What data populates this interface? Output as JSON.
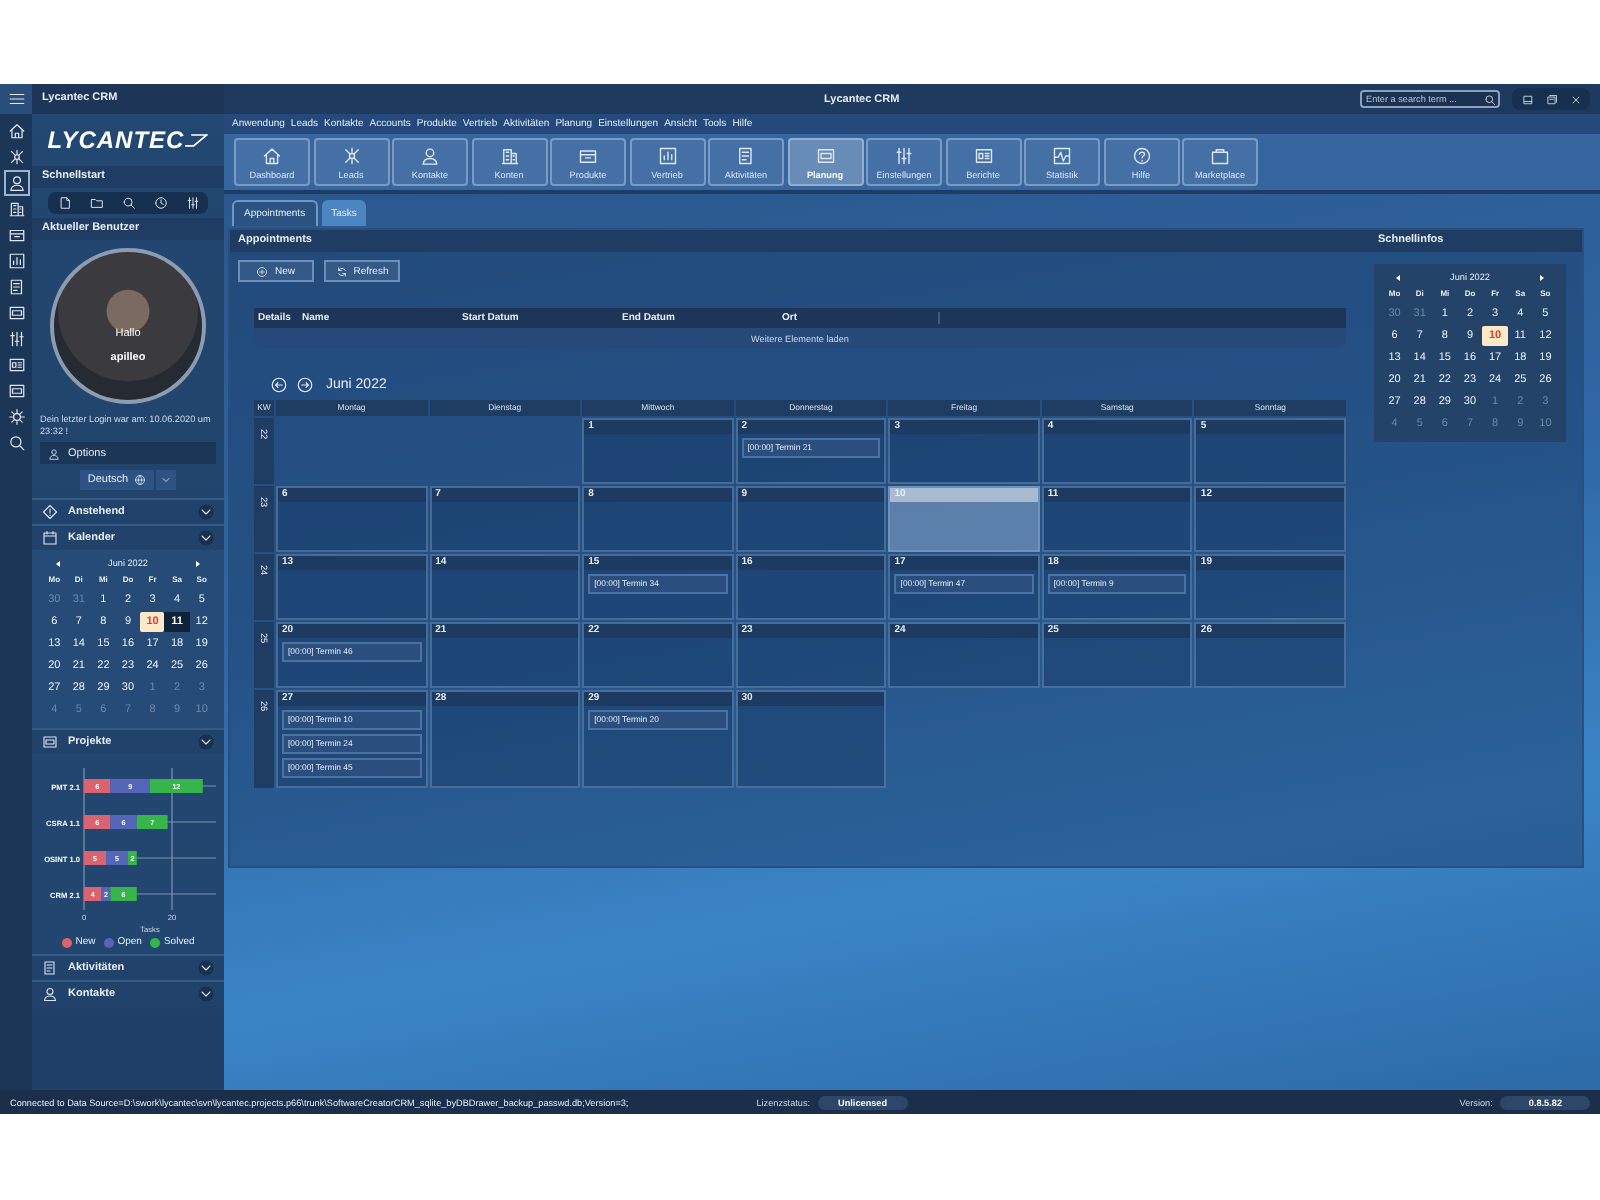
{
  "left_panel": {
    "title": "Lycantec CRM",
    "logo": "LYCANTEC",
    "quickstart": {
      "title": "Schnellstart"
    },
    "user": {
      "title": "Aktueller Benutzer",
      "greeting": "Hallo",
      "name": "apilleo",
      "last_login": "Dein letzter Login war am:  10.06.2020 um 23:32 !",
      "options": "Options",
      "language": "Deutsch"
    },
    "sections": [
      {
        "title": "Anstehend",
        "kind": "plain"
      },
      {
        "title": "Kalender",
        "kind": "calendar",
        "calendar": {
          "month": "Juni 2022",
          "weekdays": [
            "Mo",
            "Di",
            "Mi",
            "Do",
            "Fr",
            "Sa",
            "So"
          ],
          "days": [
            {
              "label": "30",
              "outside": true,
              "today": false,
              "selected": false
            },
            {
              "label": "31",
              "outside": true,
              "today": false,
              "selected": false
            },
            {
              "label": "1",
              "outside": false,
              "today": false,
              "selected": false
            },
            {
              "label": "2",
              "outside": false,
              "today": false,
              "selected": false
            },
            {
              "label": "3",
              "outside": false,
              "today": false,
              "selected": false
            },
            {
              "label": "4",
              "outside": false,
              "today": false,
              "selected": false
            },
            {
              "label": "5",
              "outside": false,
              "today": false,
              "selected": false
            },
            {
              "label": "6",
              "outside": false,
              "today": false,
              "selected": false
            },
            {
              "label": "7",
              "outside": false,
              "today": false,
              "selected": false
            },
            {
              "label": "8",
              "outside": false,
              "today": false,
              "selected": false
            },
            {
              "label": "9",
              "outside": false,
              "today": false,
              "selected": false
            },
            {
              "label": "10",
              "outside": false,
              "today": true,
              "selected": false
            },
            {
              "label": "11",
              "outside": false,
              "today": false,
              "selected": true
            },
            {
              "label": "12",
              "outside": false,
              "today": false,
              "selected": false
            },
            {
              "label": "13",
              "outside": false,
              "today": false,
              "selected": false
            },
            {
              "label": "14",
              "outside": false,
              "today": false,
              "selected": false
            },
            {
              "label": "15",
              "outside": false,
              "today": false,
              "selected": false
            },
            {
              "label": "16",
              "outside": false,
              "today": false,
              "selected": false
            },
            {
              "label": "17",
              "outside": false,
              "today": false,
              "selected": false
            },
            {
              "label": "18",
              "outside": false,
              "today": false,
              "selected": false
            },
            {
              "label": "19",
              "outside": false,
              "today": false,
              "selected": false
            },
            {
              "label": "20",
              "outside": false,
              "today": false,
              "selected": false
            },
            {
              "label": "21",
              "outside": false,
              "today": false,
              "selected": false
            },
            {
              "label": "22",
              "outside": false,
              "today": false,
              "selected": false
            },
            {
              "label": "23",
              "outside": false,
              "today": false,
              "selected": false
            },
            {
              "label": "24",
              "outside": false,
              "today": false,
              "selected": false
            },
            {
              "label": "25",
              "outside": false,
              "today": false,
              "selected": false
            },
            {
              "label": "26",
              "outside": false,
              "today": false,
              "selected": false
            },
            {
              "label": "27",
              "outside": false,
              "today": false,
              "selected": false
            },
            {
              "label": "28",
              "outside": false,
              "today": false,
              "selected": false
            },
            {
              "label": "29",
              "outside": false,
              "today": false,
              "selected": false
            },
            {
              "label": "30",
              "outside": false,
              "today": false,
              "selected": false
            },
            {
              "label": "1",
              "outside": true,
              "today": false,
              "selected": false
            },
            {
              "label": "2",
              "outside": true,
              "today": false,
              "selected": false
            },
            {
              "label": "3",
              "outside": true,
              "today": false,
              "selected": false
            },
            {
              "label": "4",
              "outside": true,
              "today": false,
              "selected": false
            },
            {
              "label": "5",
              "outside": true,
              "today": false,
              "selected": false
            },
            {
              "label": "6",
              "outside": true,
              "today": false,
              "selected": false
            },
            {
              "label": "7",
              "outside": true,
              "today": false,
              "selected": false
            },
            {
              "label": "8",
              "outside": true,
              "today": false,
              "selected": false
            },
            {
              "label": "9",
              "outside": true,
              "today": false,
              "selected": false
            },
            {
              "label": "10",
              "outside": true,
              "today": false,
              "selected": false
            }
          ]
        }
      },
      {
        "title": "Projekte",
        "kind": "chart",
        "chart_data": {
          "type": "bar",
          "orientation": "horizontal",
          "stacked": true,
          "xlabel": "Tasks",
          "categories": [
            "PMT 2.1",
            "CSRA 1.1",
            "OSINT 1.0",
            "CRM 2.1"
          ],
          "series": [
            {
              "name": "New",
              "color": "#d9636f",
              "values": [
                6,
                6,
                5,
                4
              ]
            },
            {
              "name": "Open",
              "color": "#5566b8",
              "values": [
                9,
                6,
                5,
                2
              ]
            },
            {
              "name": "Solved",
              "color": "#35b54a",
              "values": [
                12,
                7,
                2,
                6
              ]
            }
          ],
          "xlim": [
            0,
            30
          ],
          "xticks": [
            0,
            20
          ],
          "data_labels": true,
          "ref_lines": [
            {
              "axis": "x",
              "value": 20
            }
          ],
          "legend": "bottom"
        }
      },
      {
        "title": "Aktivitäten",
        "kind": "plain"
      },
      {
        "title": "Kontakte",
        "kind": "plain"
      }
    ]
  },
  "window": {
    "title": "Lycantec CRM",
    "search": {
      "placeholder": "Enter a search term ..."
    }
  },
  "menu": [
    "Anwendung",
    "Leads",
    "Kontakte",
    "Accounts",
    "Produkte",
    "Vertrieb",
    "Aktivitäten",
    "Planung",
    "Einstellungen",
    "Ansicht",
    "Tools",
    "Hilfe"
  ],
  "ribbon": {
    "buttons": [
      {
        "label": "Dashboard",
        "selected": false
      },
      {
        "label": "Leads",
        "selected": false
      },
      {
        "label": "Kontakte",
        "selected": false
      },
      {
        "label": "Konten",
        "selected": false
      },
      {
        "label": "Produkte",
        "selected": false
      },
      {
        "label": "Vertrieb",
        "selected": false
      },
      {
        "label": "Aktivitäten",
        "selected": false
      },
      {
        "label": "Planung",
        "selected": true
      },
      {
        "label": "Einstellungen",
        "selected": false
      },
      {
        "label": "Berichte",
        "selected": false
      },
      {
        "label": "Statistik",
        "selected": false
      },
      {
        "label": "Hilfe",
        "selected": false
      },
      {
        "label": "Marketplace",
        "selected": false
      }
    ]
  },
  "tabs": [
    {
      "label": "Appointments",
      "selected": true
    },
    {
      "label": "Tasks",
      "selected": false
    }
  ],
  "appointments": {
    "title": "Appointments",
    "buttons": [
      "New",
      "Refresh"
    ],
    "table": {
      "columns": [
        "Details",
        "Name",
        "Start Datum",
        "End Datum",
        "Ort"
      ],
      "load_more": "Weitere Elemente laden"
    }
  },
  "calendar": {
    "month": "Juni 2022",
    "kw_label": "KW",
    "weekdays": [
      "Montag",
      "Dienstag",
      "Mittwoch",
      "Donnerstag",
      "Freitag",
      "Samstag",
      "Sonntag"
    ],
    "weeks": [
      {
        "kw": "22",
        "days": [
          {
            "kind": "blank"
          },
          {
            "kind": "blank"
          },
          {
            "kind": "day",
            "label": "1",
            "today": false
          },
          {
            "kind": "day",
            "label": "2",
            "today": false,
            "events": [
              "[00:00] Termin 21"
            ]
          },
          {
            "kind": "day",
            "label": "3",
            "today": false
          },
          {
            "kind": "day",
            "label": "4",
            "today": false
          },
          {
            "kind": "day",
            "label": "5",
            "today": false
          }
        ]
      },
      {
        "kw": "23",
        "days": [
          {
            "kind": "day",
            "label": "6",
            "today": false
          },
          {
            "kind": "day",
            "label": "7",
            "today": false
          },
          {
            "kind": "day",
            "label": "8",
            "today": false
          },
          {
            "kind": "day",
            "label": "9",
            "today": false
          },
          {
            "kind": "day",
            "label": "10",
            "today": true
          },
          {
            "kind": "day",
            "label": "11",
            "today": false
          },
          {
            "kind": "day",
            "label": "12",
            "today": false
          }
        ]
      },
      {
        "kw": "24",
        "days": [
          {
            "kind": "day",
            "label": "13",
            "today": false
          },
          {
            "kind": "day",
            "label": "14",
            "today": false
          },
          {
            "kind": "day",
            "label": "15",
            "today": false,
            "events": [
              "[00:00] Termin 34"
            ]
          },
          {
            "kind": "day",
            "label": "16",
            "today": false
          },
          {
            "kind": "day",
            "label": "17",
            "today": false,
            "events": [
              "[00:00] Termin 47"
            ]
          },
          {
            "kind": "day",
            "label": "18",
            "today": false,
            "events": [
              "[00:00] Termin 9"
            ]
          },
          {
            "kind": "day",
            "label": "19",
            "today": false
          }
        ]
      },
      {
        "kw": "25",
        "days": [
          {
            "kind": "day",
            "label": "20",
            "today": false,
            "events": [
              "[00:00] Termin 46"
            ]
          },
          {
            "kind": "day",
            "label": "21",
            "today": false
          },
          {
            "kind": "day",
            "label": "22",
            "today": false
          },
          {
            "kind": "day",
            "label": "23",
            "today": false
          },
          {
            "kind": "day",
            "label": "24",
            "today": false
          },
          {
            "kind": "day",
            "label": "25",
            "today": false
          },
          {
            "kind": "day",
            "label": "26",
            "today": false
          }
        ]
      },
      {
        "kw": "26",
        "days": [
          {
            "kind": "day",
            "label": "27",
            "today": false,
            "events": [
              "[00:00] Termin 10",
              "[00:00] Termin 24",
              "[00:00] Termin 45"
            ]
          },
          {
            "kind": "day",
            "label": "28",
            "today": false
          },
          {
            "kind": "day",
            "label": "29",
            "today": false,
            "events": [
              "[00:00] Termin 20"
            ]
          },
          {
            "kind": "day",
            "label": "30",
            "today": false
          }
        ]
      }
    ]
  },
  "quick_info": {
    "title": "Schnellinfos",
    "calendar": {
      "month": "Juni 2022",
      "weekdays": [
        "Mo",
        "Di",
        "Mi",
        "Do",
        "Fr",
        "Sa",
        "So"
      ],
      "days": [
        {
          "label": "30",
          "outside": true,
          "today": false,
          "selected": false
        },
        {
          "label": "31",
          "outside": true,
          "today": false,
          "selected": false
        },
        {
          "label": "1",
          "outside": false,
          "today": false,
          "selected": false
        },
        {
          "label": "2",
          "outside": false,
          "today": false,
          "selected": false
        },
        {
          "label": "3",
          "outside": false,
          "today": false,
          "selected": false
        },
        {
          "label": "4",
          "outside": false,
          "today": false,
          "selected": false
        },
        {
          "label": "5",
          "outside": false,
          "today": false,
          "selected": false
        },
        {
          "label": "6",
          "outside": false,
          "today": false,
          "selected": false
        },
        {
          "label": "7",
          "outside": false,
          "today": false,
          "selected": false
        },
        {
          "label": "8",
          "outside": false,
          "today": false,
          "selected": false
        },
        {
          "label": "9",
          "outside": false,
          "today": false,
          "selected": false
        },
        {
          "label": "10",
          "outside": false,
          "today": true,
          "selected": false
        },
        {
          "label": "11",
          "outside": false,
          "today": false,
          "selected": false
        },
        {
          "label": "12",
          "outside": false,
          "today": false,
          "selected": false
        },
        {
          "label": "13",
          "outside": false,
          "today": false,
          "selected": false
        },
        {
          "label": "14",
          "outside": false,
          "today": false,
          "selected": false
        },
        {
          "label": "15",
          "outside": false,
          "today": false,
          "selected": false
        },
        {
          "label": "16",
          "outside": false,
          "today": false,
          "selected": false
        },
        {
          "label": "17",
          "outside": false,
          "today": false,
          "selected": false
        },
        {
          "label": "18",
          "outside": false,
          "today": false,
          "selected": false
        },
        {
          "label": "19",
          "outside": false,
          "today": false,
          "selected": false
        },
        {
          "label": "20",
          "outside": false,
          "today": false,
          "selected": false
        },
        {
          "label": "21",
          "outside": false,
          "today": false,
          "selected": false
        },
        {
          "label": "22",
          "outside": false,
          "today": false,
          "selected": false
        },
        {
          "label": "23",
          "outside": false,
          "today": false,
          "selected": false
        },
        {
          "label": "24",
          "outside": false,
          "today": false,
          "selected": false
        },
        {
          "label": "25",
          "outside": false,
          "today": false,
          "selected": false
        },
        {
          "label": "26",
          "outside": false,
          "today": false,
          "selected": false
        },
        {
          "label": "27",
          "outside": false,
          "today": false,
          "selected": false
        },
        {
          "label": "28",
          "outside": false,
          "today": false,
          "selected": false
        },
        {
          "label": "29",
          "outside": false,
          "today": false,
          "selected": false
        },
        {
          "label": "30",
          "outside": false,
          "today": false,
          "selected": false
        },
        {
          "label": "1",
          "outside": true,
          "today": false,
          "selected": false
        },
        {
          "label": "2",
          "outside": true,
          "today": false,
          "selected": false
        },
        {
          "label": "3",
          "outside": true,
          "today": false,
          "selected": false
        },
        {
          "label": "4",
          "outside": true,
          "today": false,
          "selected": false
        },
        {
          "label": "5",
          "outside": true,
          "today": false,
          "selected": false
        },
        {
          "label": "6",
          "outside": true,
          "today": false,
          "selected": false
        },
        {
          "label": "7",
          "outside": true,
          "today": false,
          "selected": false
        },
        {
          "label": "8",
          "outside": true,
          "today": false,
          "selected": false
        },
        {
          "label": "9",
          "outside": true,
          "today": false,
          "selected": false
        },
        {
          "label": "10",
          "outside": true,
          "today": false,
          "selected": false
        }
      ]
    }
  },
  "status_bar": {
    "connection": "Connected to Data Source=D:\\swork\\lycantec\\svn\\lycantec.projects.p66\\trunk\\SoftwareCreatorCRM_sqlite_byDBDrawer_backup_passwd.db;Version=3;",
    "license_label": "Lizenzstatus:",
    "license": "Unlicensed",
    "version_label": "Version:",
    "version": "0.8.5.82"
  }
}
